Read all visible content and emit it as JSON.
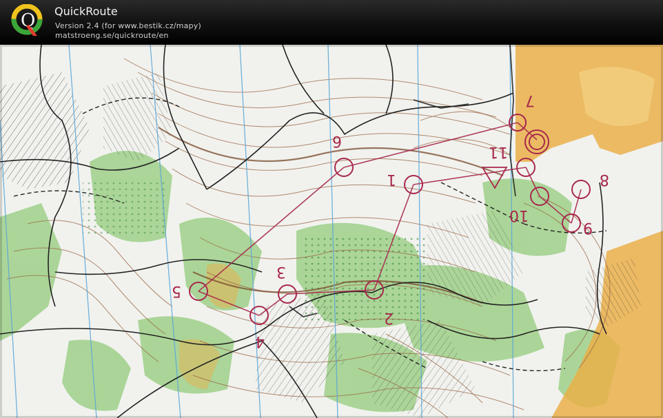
{
  "header": {
    "app_name": "QuickRoute",
    "version_line": "Version 2.4  (for www.bestik.cz/mapy)",
    "url_line": "matstroeng.se/quickroute/en",
    "logo_letter": "Q"
  },
  "map": {
    "control_numbers": [
      "1",
      "2",
      "3",
      "4",
      "5",
      "6",
      "7",
      "8",
      "9",
      "10",
      "11"
    ],
    "colors": {
      "course": "#a8284c",
      "contour": "#8b5a3c",
      "vegetation": "#8cc878",
      "open_land": "#e9a83a",
      "meridian": "#5aa5d8",
      "path": "#222222"
    }
  }
}
